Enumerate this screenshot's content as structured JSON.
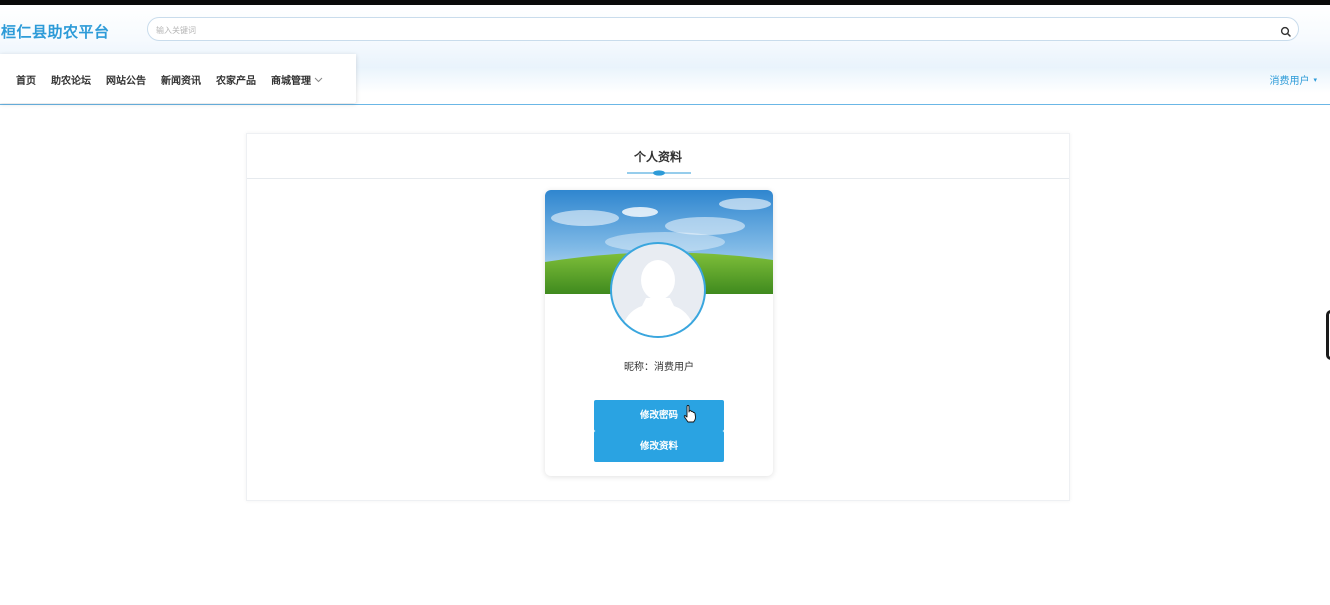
{
  "header": {
    "logo": "桓仁县助农平台",
    "search_placeholder": "输入关键词"
  },
  "nav": {
    "items": [
      {
        "label": "首页"
      },
      {
        "label": "助农论坛"
      },
      {
        "label": "网站公告"
      },
      {
        "label": "新闻资讯"
      },
      {
        "label": "农家产品"
      },
      {
        "label": "商城管理",
        "has_dropdown": true
      }
    ],
    "user_label": "消费用户"
  },
  "profile": {
    "title": "个人资料",
    "nickname": "昵称：消费用户",
    "change_password_label": "修改密码",
    "edit_profile_label": "修改资料"
  },
  "colors": {
    "brand": "#2d9bd8",
    "button": "#2aa3e2"
  },
  "icons": [
    "search-icon",
    "chevron-down-icon",
    "avatar-placeholder-icon",
    "hand-pointer-icon"
  ]
}
